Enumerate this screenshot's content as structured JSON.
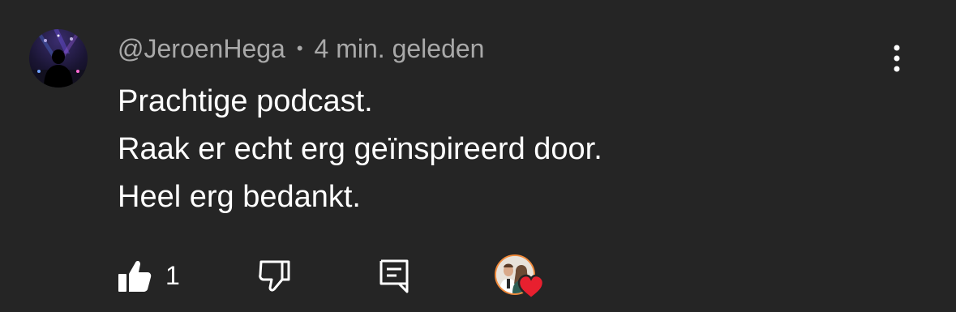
{
  "comment": {
    "username": "@JeroenHega",
    "separator": "•",
    "timestamp": "4 min. geleden",
    "lines": [
      "Prachtige podcast.",
      "Raak er echt erg geïnspireerd door.",
      "Heel erg bedankt."
    ],
    "avatar_icon": "user-avatar-dj-silhouette",
    "more_icon": "more-vertical-icon"
  },
  "actions": {
    "like_icon": "thumbs-up-icon",
    "like_count": "1",
    "dislike_icon": "thumbs-down-icon",
    "reply_icon": "reply-comment-icon",
    "creator_heart_icon": "heart-icon",
    "heart_color": "#e8202f",
    "creator_ring_color": "#f08a3b"
  }
}
